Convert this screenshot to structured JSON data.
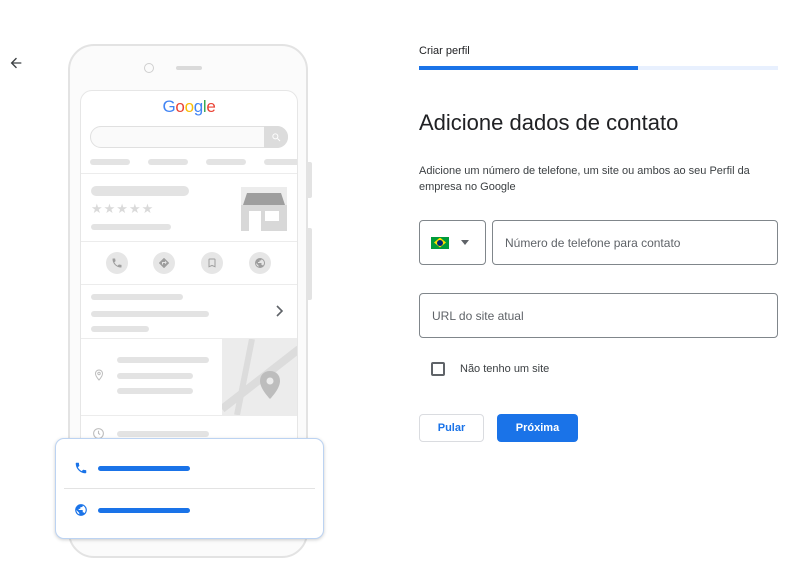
{
  "nav": {
    "back_icon": "arrow-back-icon"
  },
  "illustration": {
    "logo_letters": [
      {
        "char": "G",
        "color": "#4285F4"
      },
      {
        "char": "o",
        "color": "#EA4335"
      },
      {
        "char": "o",
        "color": "#FBBC05"
      },
      {
        "char": "g",
        "color": "#4285F4"
      },
      {
        "char": "l",
        "color": "#34A853"
      },
      {
        "char": "e",
        "color": "#EA4335"
      }
    ],
    "rating_stars": "★★★★★",
    "card_icons": [
      "phone-icon",
      "globe-icon"
    ]
  },
  "form": {
    "step_title": "Criar perfil",
    "progress": 0.61,
    "heading": "Adicione dados de contato",
    "description": "Adicione um número de telefone, um site ou ambos ao seu Perfil da empresa no Google",
    "country_flag": "brazil-flag-icon",
    "phone_placeholder": "Número de telefone para contato",
    "url_placeholder": "URL do site atual",
    "no_site_label": "Não tenho um site",
    "no_site_checked": false,
    "skip_label": "Pular",
    "next_label": "Próxima"
  },
  "colors": {
    "accent": "#1a73e8",
    "border": "#80868b"
  }
}
